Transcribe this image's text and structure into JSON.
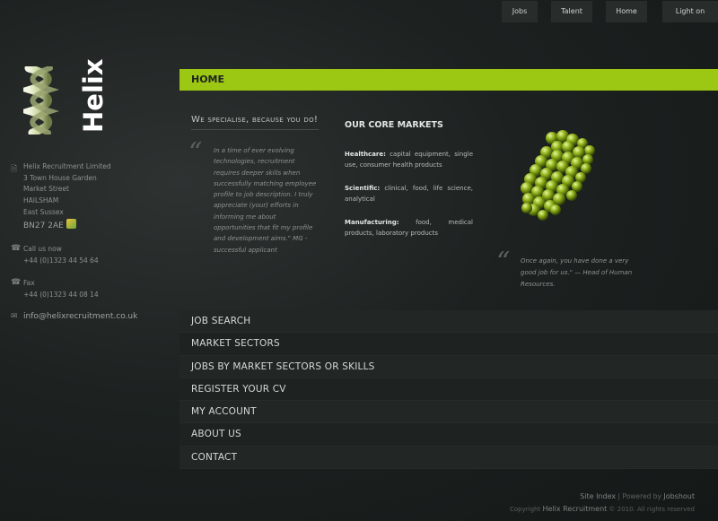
{
  "topnav": {
    "items": [
      "Jobs",
      "Talent",
      "Home",
      "Light on"
    ]
  },
  "logo": {
    "text": "Helix"
  },
  "contact": {
    "address": [
      "Helix Recruitment Limited",
      "3 Town House Garden",
      "Market Street",
      "HAILSHAM",
      "East Sussex"
    ],
    "postcode": "BN27 2AE",
    "call_label": "Call us now",
    "call_number": "+44 (0)1323 44 54 64",
    "fax_label": "Fax",
    "fax_number": "+44 (0)1323 44 08 14",
    "email": "info@helixrecruitment.co.uk"
  },
  "homebar": {
    "title": "HOME"
  },
  "specialise": {
    "title": "We specialise, because you do!",
    "quote": "In a time of ever evolving technologies, recruitment requires deeper skills when successfully matching employee profile to job description. I truly appreciate (your) efforts in informing me about opportunities that fit my profile and development aims.\" MG - successful applicant"
  },
  "core": {
    "title": "OUR CORE MARKETS",
    "items": [
      {
        "label": "Healthcare:",
        "text": " capital equipment, single use, consumer health products"
      },
      {
        "label": "Scientific:",
        "text": " clinical, food, life science, analytical"
      },
      {
        "label": "Manufacturing:",
        "text": " food, medical products, laboratory products"
      }
    ]
  },
  "right_quote": {
    "text": "Once again, you have done a very good job for us.\" — Head of Human Resources."
  },
  "menu": {
    "items": [
      "JOB SEARCH",
      "MARKET SECTORS",
      "JOBS BY MARKET SECTORS OR SKILLS",
      "REGISTER YOUR CV",
      "MY ACCOUNT",
      "ABOUT US",
      "CONTACT"
    ]
  },
  "footer": {
    "site_index": "Site Index",
    "powered_by": "| Powered by",
    "powered_brand": "Jobshout",
    "copyright_prefix": "Copyright",
    "copyright_brand": "Helix Recruitment",
    "copyright_suffix": "© 2010. All rights reserved"
  },
  "colors": {
    "accent": "#9cc712",
    "background": "#1d2221",
    "menu_bg": "#222726"
  }
}
